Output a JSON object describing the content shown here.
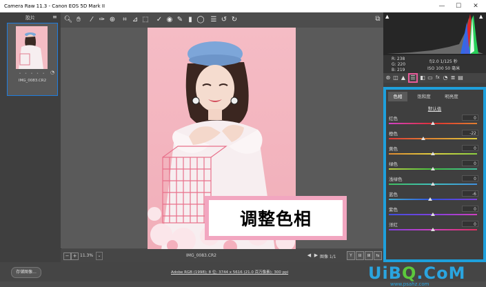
{
  "window": {
    "title": "Camera Raw 11.3 -  Canon EOS 5D Mark II",
    "min_glyph": "—",
    "max_glyph": "☐",
    "close_glyph": "✕"
  },
  "filmstrip": {
    "title": "胶片",
    "menu_glyph": "≡",
    "thumbnail": {
      "filename": "IMG_0083.CR2",
      "stars": "• • • • •",
      "badge": "◔"
    }
  },
  "toolbar": {
    "tools": [
      {
        "name": "zoom-icon",
        "glyph": "🔍︎"
      },
      {
        "name": "hand-icon",
        "glyph": "✋︎"
      },
      {
        "name": "white-balance-icon",
        "glyph": "⁄"
      },
      {
        "name": "color-sampler-icon",
        "glyph": "✑"
      },
      {
        "name": "targeted-adjust-icon",
        "glyph": "⊕"
      },
      {
        "name": "crop-icon",
        "glyph": "⌗"
      },
      {
        "name": "straighten-icon",
        "glyph": "⊿"
      },
      {
        "name": "transform-icon",
        "glyph": "⬚"
      },
      {
        "name": "spot-removal-icon",
        "glyph": "✓"
      },
      {
        "name": "red-eye-icon",
        "glyph": "◉"
      },
      {
        "name": "adjustment-brush-icon",
        "glyph": "✎"
      },
      {
        "name": "graduated-filter-icon",
        "glyph": "▮"
      },
      {
        "name": "radial-filter-icon",
        "glyph": "◯"
      },
      {
        "name": "preferences-icon",
        "glyph": "☰"
      },
      {
        "name": "rotate-ccw-icon",
        "glyph": "↺"
      },
      {
        "name": "rotate-cw-icon",
        "glyph": "↻"
      }
    ],
    "fullscreen_glyph": "⧉"
  },
  "overlay_label": "调整色相",
  "statusbar": {
    "zoom_minus": "−",
    "zoom_plus": "+",
    "zoom_value": "11.3%",
    "zoom_dropdown": "⌄",
    "filename": "IMG_0083.CR2",
    "prev": "◀",
    "next": "▶",
    "image_count": "图像 1/1",
    "view_buttons": [
      "Y",
      "⊟",
      "⊞",
      "⇆"
    ]
  },
  "footer": {
    "save_label": "存储图像...",
    "workflow_text": "Adobe RGB (1998); 8 位; 3744 x 5616 (21.0 百万像素); 300 ppi",
    "watermark": {
      "part1": "UiB",
      "part2": "Q",
      "part3": ".CoM"
    },
    "watermark_url": "www.psahz.com"
  },
  "histogram": {
    "shadow_clip": "▲",
    "highlight_clip": "▲",
    "colors": {
      "red": "#ff2a2a",
      "green": "#2aff5a",
      "blue": "#2a7aff",
      "white": "#ffffff"
    }
  },
  "readout": {
    "r": "R:   238",
    "g": "G:   220",
    "b": "B:   219",
    "aperture_shutter": "f/2.0   1/125 秒",
    "iso_focal": "ISO 100   50 毫米"
  },
  "panel_tabs": [
    {
      "name": "basic-icon",
      "glyph": "⊛"
    },
    {
      "name": "tone-curve-icon",
      "glyph": "◫"
    },
    {
      "name": "detail-icon",
      "glyph": "▲"
    },
    {
      "name": "hsl-icon",
      "glyph": "☰"
    },
    {
      "name": "split-toning-icon",
      "glyph": "◧"
    },
    {
      "name": "lens-icon",
      "glyph": "▭"
    },
    {
      "name": "effects-icon",
      "glyph": "fx"
    },
    {
      "name": "calibration-icon",
      "glyph": "◔"
    },
    {
      "name": "presets-icon",
      "glyph": "≣"
    },
    {
      "name": "snapshots-icon",
      "glyph": "▤"
    }
  ],
  "hsl": {
    "subtabs": [
      "色相",
      "饱和度",
      "明亮度"
    ],
    "active_subtab": "色相",
    "default_label": "默认值",
    "sliders": [
      {
        "label": "红色",
        "value": "0",
        "position": 0.5,
        "track": "linear-gradient(90deg,#d042c8,#e03030,#e08030)"
      },
      {
        "label": "橙色",
        "value": "-22",
        "position": 0.39,
        "track": "linear-gradient(90deg,#e03838,#e08a30,#e0d040)"
      },
      {
        "label": "黄色",
        "value": "0",
        "position": 0.5,
        "track": "linear-gradient(90deg,#e08a30,#e0d040,#8ad040)"
      },
      {
        "label": "绿色",
        "value": "0",
        "position": 0.5,
        "track": "linear-gradient(90deg,#c0d040,#40c040,#40c0a0)"
      },
      {
        "label": "浅绿色",
        "value": "0",
        "position": 0.5,
        "track": "linear-gradient(90deg,#40c060,#40c0c0,#4090e0)"
      },
      {
        "label": "蓝色",
        "value": "-6",
        "position": 0.47,
        "track": "linear-gradient(90deg,#40b0d0,#3050e0,#8040e0)"
      },
      {
        "label": "紫色",
        "value": "0",
        "position": 0.5,
        "track": "linear-gradient(90deg,#4050e0,#8040e0,#d040c0)"
      },
      {
        "label": "洋红",
        "value": "0",
        "position": 0.5,
        "track": "linear-gradient(90deg,#8040e0,#d040c0,#e03060)"
      }
    ]
  }
}
